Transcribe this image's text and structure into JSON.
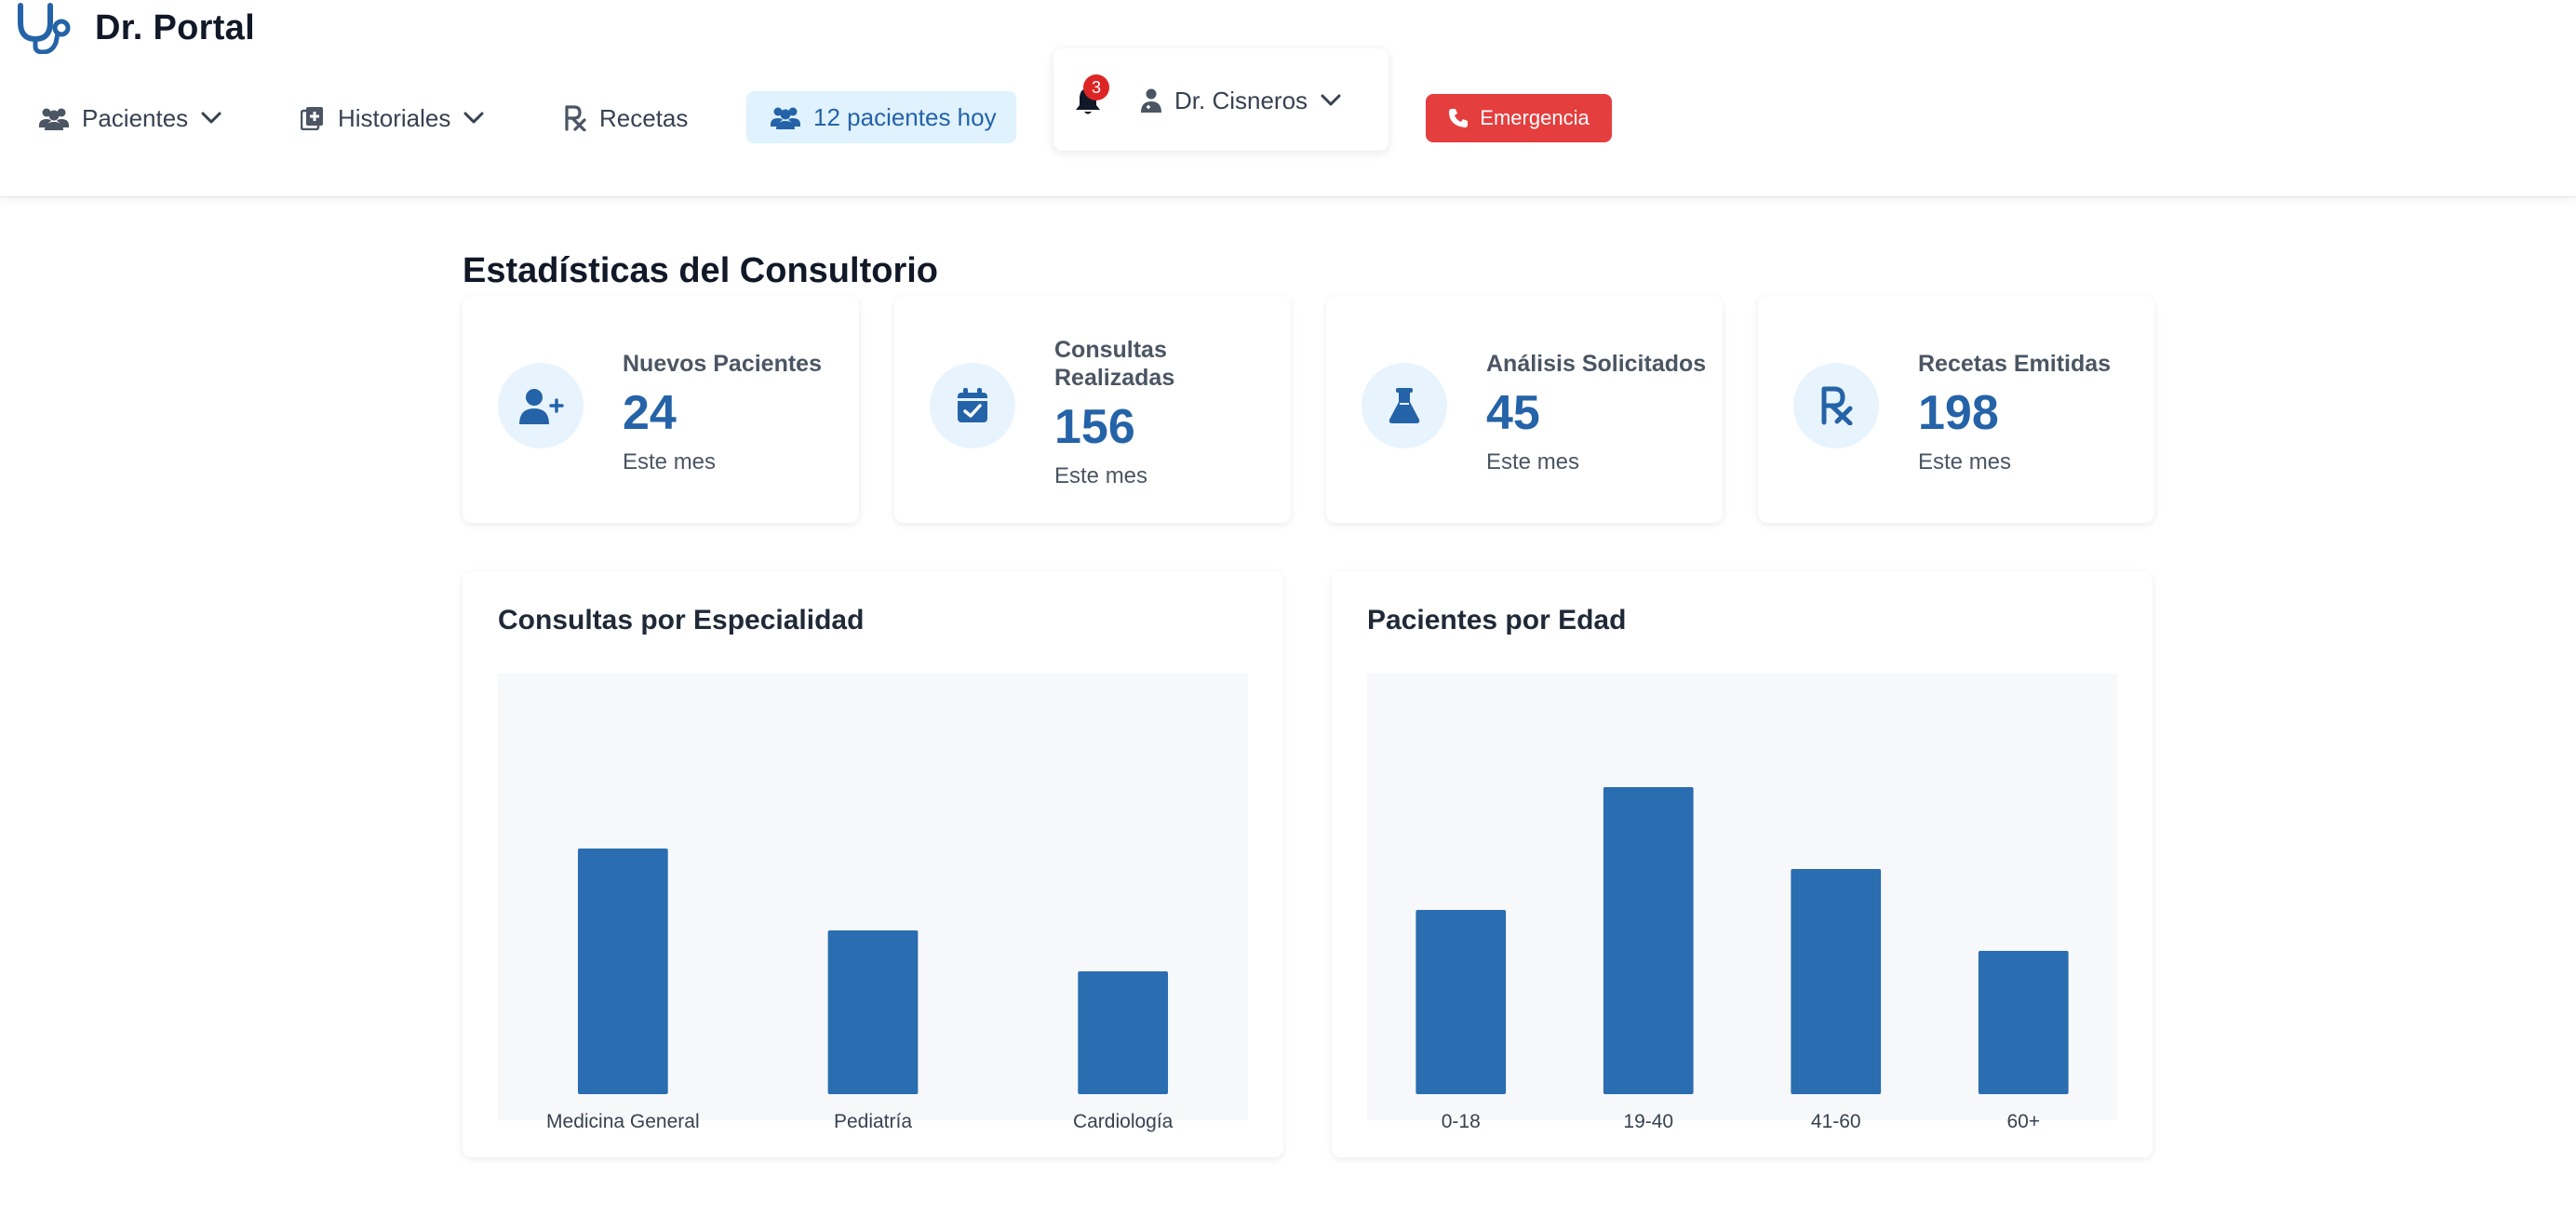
{
  "app": {
    "title": "Dr. Portal"
  },
  "nav": {
    "patients_label": "Pacientes",
    "records_label": "Historiales",
    "prescriptions_label": "Recetas",
    "today_label": "12 pacientes hoy"
  },
  "notifications": {
    "count": "3"
  },
  "user": {
    "name": "Dr. Cisneros"
  },
  "emergency": {
    "label": "Emergencia"
  },
  "colors": {
    "primary": "#2563a8",
    "accent_bg": "#e8f4fd",
    "danger": "#e53e3e",
    "badge": "#dc2626"
  },
  "page": {
    "title": "Estadísticas del Consultorio"
  },
  "stats": [
    {
      "icon": "user-plus-icon",
      "label": "Nuevos Pacientes",
      "value": "24",
      "sub": "Este mes"
    },
    {
      "icon": "calendar-check-icon",
      "label": "Consultas Realizadas",
      "value": "156",
      "sub": "Este mes"
    },
    {
      "icon": "flask-icon",
      "label": "Análisis Solicitados",
      "value": "45",
      "sub": "Este mes"
    },
    {
      "icon": "prescription-icon",
      "label": "Recetas Emitidas",
      "value": "198",
      "sub": "Este mes"
    }
  ],
  "chart_data": [
    {
      "type": "bar",
      "title": "Consultas por Especialidad",
      "categories": [
        "Medicina General",
        "Pediatría",
        "Cardiología"
      ],
      "values": [
        60,
        40,
        30
      ],
      "ylim": [
        0,
        100
      ],
      "grid": false,
      "color": "#2a6db0"
    },
    {
      "type": "bar",
      "title": "Pacientes por Edad",
      "categories": [
        "0-18",
        "19-40",
        "41-60",
        "60+"
      ],
      "values": [
        45,
        75,
        55,
        35
      ],
      "ylim": [
        0,
        100
      ],
      "grid": false,
      "color": "#2a6db0"
    }
  ]
}
